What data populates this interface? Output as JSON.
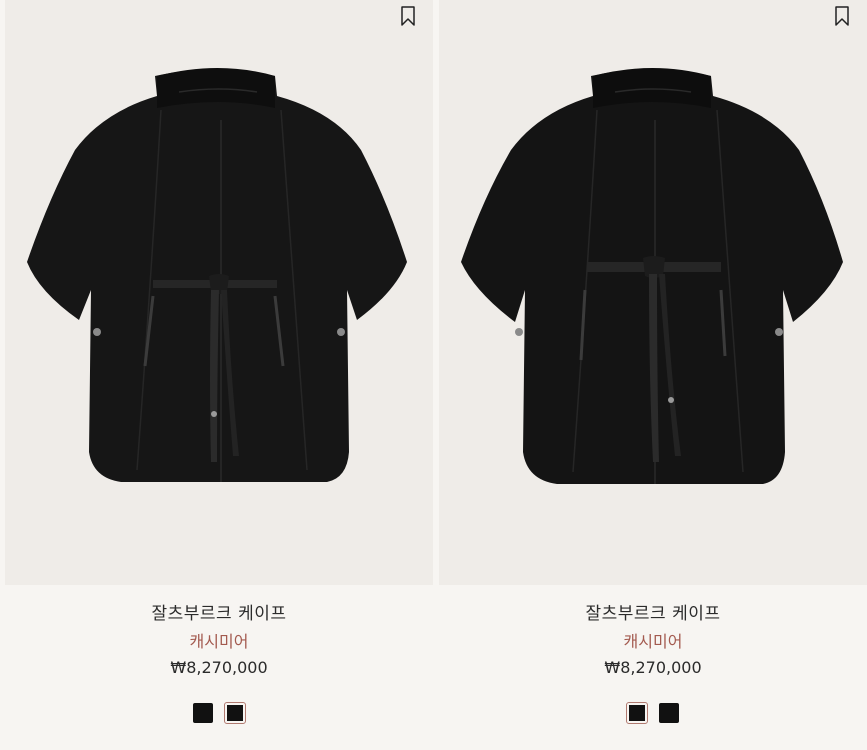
{
  "products": [
    {
      "name": "잘츠부르크 케이프",
      "material": "캐시미어",
      "price": "₩8,270,000",
      "bookmark_icon": "bookmark-icon",
      "swatches": [
        {
          "color": "#111111",
          "selected": false
        },
        {
          "color": "#111111",
          "selected": true
        }
      ]
    },
    {
      "name": "잘츠부르크 케이프",
      "material": "캐시미어",
      "price": "₩8,270,000",
      "bookmark_icon": "bookmark-icon",
      "swatches": [
        {
          "color": "#111111",
          "selected": true
        },
        {
          "color": "#111111",
          "selected": false
        }
      ]
    }
  ],
  "colors": {
    "background": "#f7f5f2",
    "image_background": "#efece8",
    "material_text": "#a35a4f",
    "text": "#2b2b2b"
  }
}
